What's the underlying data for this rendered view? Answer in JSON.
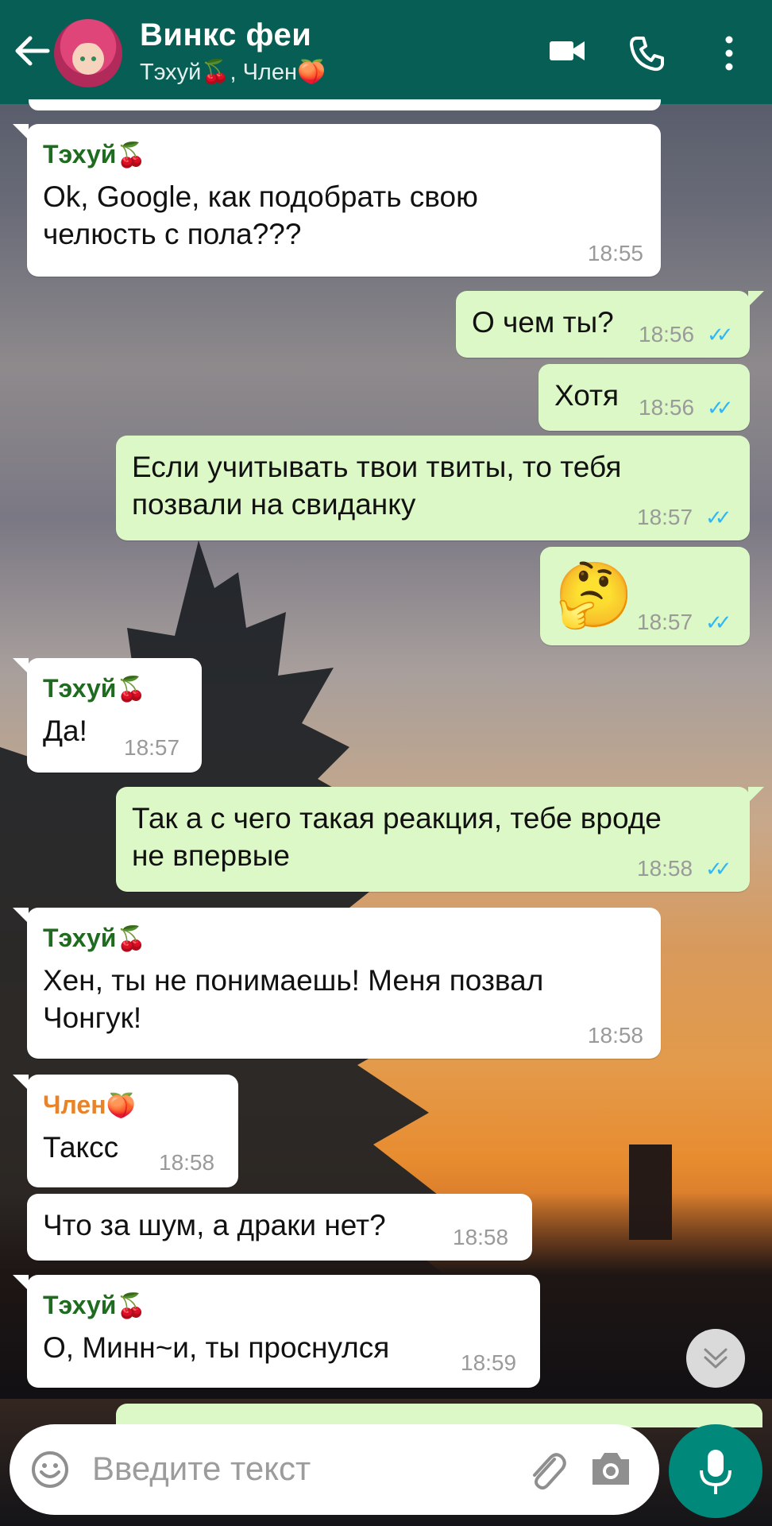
{
  "header": {
    "title": "Винкс феи",
    "subtitle": "Тэхуй🍒, Член🍑",
    "bg_color": "#075e54"
  },
  "colors": {
    "incoming_bubble": "#ffffff",
    "outgoing_bubble": "#dcf8c6",
    "read_ticks": "#34b7f1",
    "sender_taehui": "#1f6b1f",
    "sender_chlen": "#e8832a"
  },
  "messages": [
    {
      "dir": "in",
      "sender": "Тэхуй",
      "sender_emoji": "🍒",
      "text": "Ok, Google, как подобрать свою\nчелюсть с пола???",
      "time": "18:55"
    },
    {
      "dir": "out",
      "text": "О чем ты?",
      "time": "18:56",
      "ticks": "✓✓"
    },
    {
      "dir": "out",
      "text": "Хотя",
      "time": "18:56",
      "ticks": "✓✓"
    },
    {
      "dir": "out",
      "text": "Если учитывать твои твиты, то тебя\nпозвали на свиданку",
      "time": "18:57",
      "ticks": "✓✓"
    },
    {
      "dir": "out",
      "text": "🤔",
      "time": "18:57",
      "ticks": "✓✓"
    },
    {
      "dir": "in",
      "sender": "Тэхуй",
      "sender_emoji": "🍒",
      "text": "Да!",
      "time": "18:57"
    },
    {
      "dir": "out",
      "text": "Так а с чего такая реакция, тебе вроде\nне впервые",
      "time": "18:58",
      "ticks": "✓✓"
    },
    {
      "dir": "in",
      "sender": "Тэхуй",
      "sender_emoji": "🍒",
      "text": "Хен, ты не понимаешь! Меня позвал\nЧонгук!",
      "time": "18:58"
    },
    {
      "dir": "in",
      "sender": "Член",
      "sender_emoji": "🍑",
      "text": "Таксс",
      "time": "18:58"
    },
    {
      "dir": "in",
      "text": "Что за шум, а драки нет?",
      "time": "18:58"
    },
    {
      "dir": "in",
      "sender": "Тэхуй",
      "sender_emoji": "🍒",
      "text": "О, Минн~и, ты проснулся",
      "time": "18:59"
    }
  ],
  "composer": {
    "placeholder": "Введите текст"
  },
  "icons": [
    "back-arrow-icon",
    "avatar",
    "video-call-icon",
    "phone-icon",
    "more-icon",
    "emoji-icon",
    "attach-icon",
    "camera-icon",
    "mic-icon",
    "scroll-down-icon"
  ]
}
